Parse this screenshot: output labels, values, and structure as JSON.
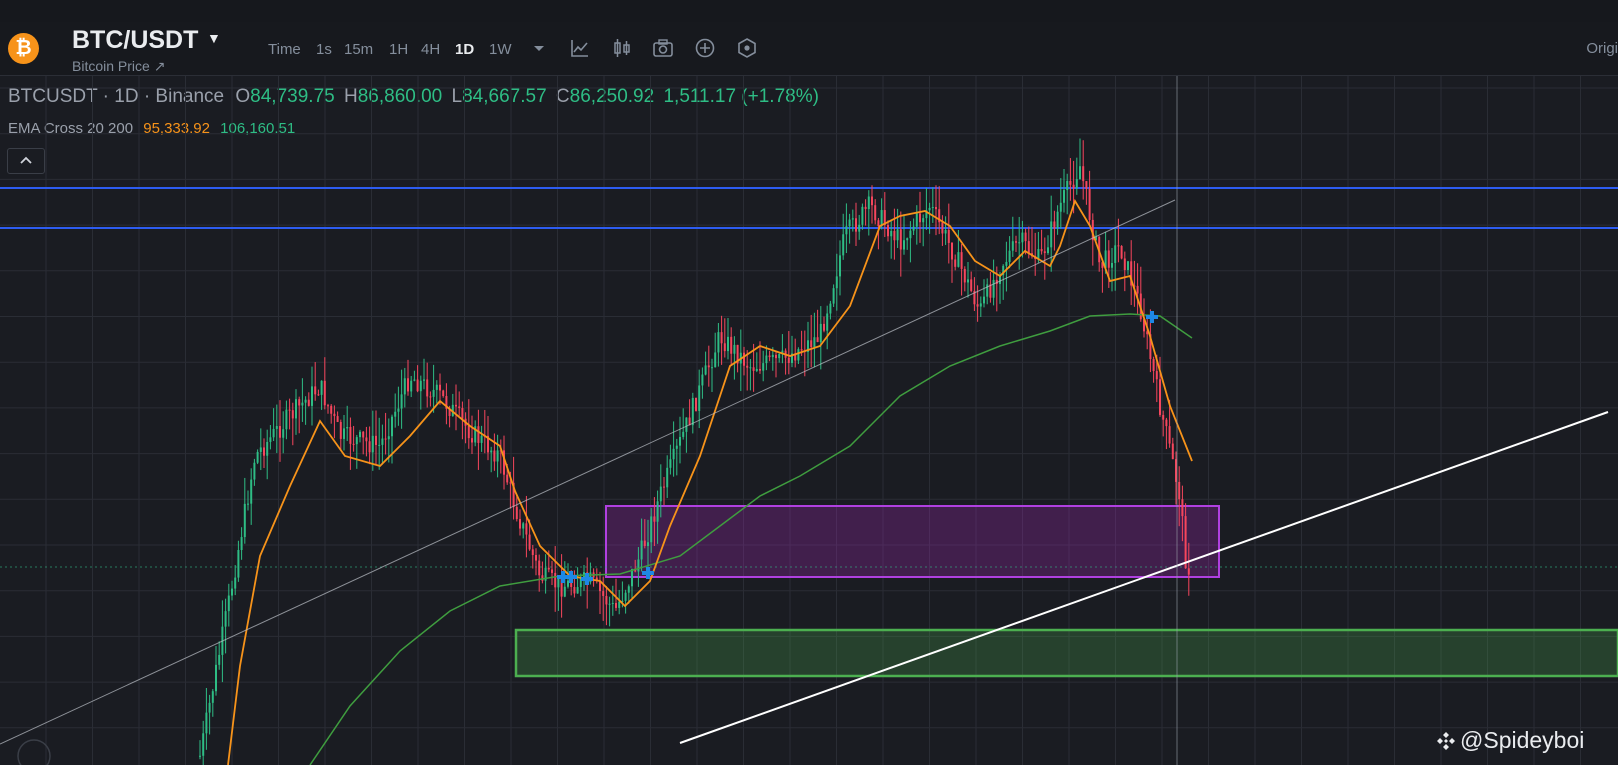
{
  "header": {
    "pair": "BTC/USDT",
    "subtitle": "Bitcoin Price ↗",
    "coin_glyph": "₿",
    "timeframes": [
      "Time",
      "1s",
      "15m",
      "1H",
      "4H",
      "1D",
      "1W"
    ],
    "active_timeframe": "1D",
    "tools": [
      "chevron-down-icon",
      "line-chart-icon",
      "candlestick-icon",
      "camera-icon",
      "plus-circle-icon",
      "settings-hex-icon"
    ],
    "right_label": "Origi"
  },
  "legend": {
    "symbol": "BTCUSDT · 1D · Binance",
    "o_label": "O",
    "o": "84,739.75",
    "h_label": "H",
    "h": "86,860.00",
    "l_label": "L",
    "l": "84,667.57",
    "c_label": "C",
    "c": "86,250.92",
    "change": "1,511.17 (+1.78%)",
    "ema_label": "EMA Cross 20 200",
    "ema20": "95,333.92",
    "ema200": "106,160.51"
  },
  "watermark": "@Spideyboi",
  "colors": {
    "up": "#2ebd85",
    "down": "#f6465d",
    "ema20": "#f7931a",
    "ema200": "#3f9d3f",
    "hline": "#2d5cf0",
    "box_purple": "#b040e0",
    "box_green": "#4caf50",
    "marker": "#1e88e5"
  }
}
